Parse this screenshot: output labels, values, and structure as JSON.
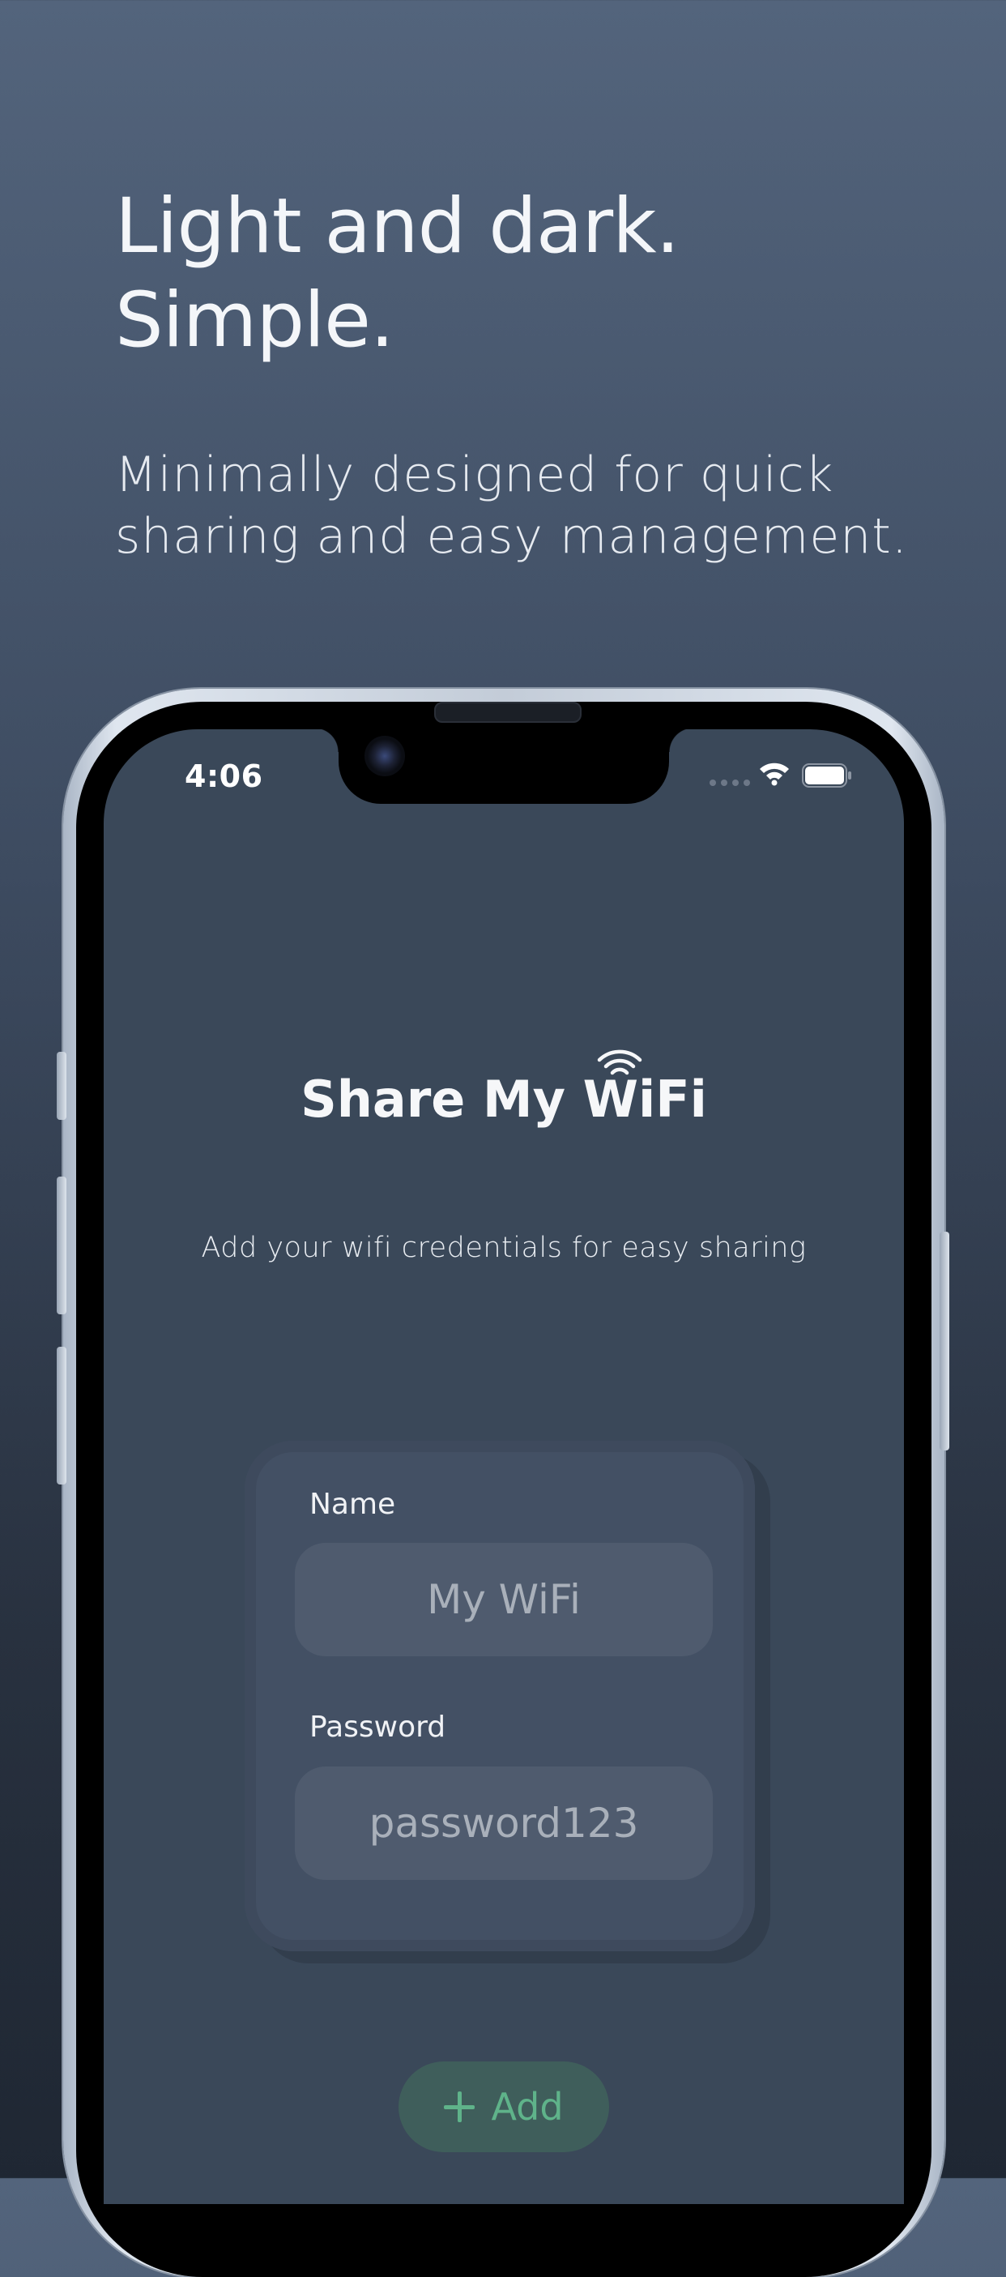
{
  "promo": {
    "headline_line1": "Light and dark.",
    "headline_line2": "Simple.",
    "subtitle_line1": "Minimally designed for quick",
    "subtitle_line2": "sharing and easy management."
  },
  "status_bar": {
    "time": "4:06",
    "icons": [
      "signal-icon",
      "wifi-icon",
      "battery-icon"
    ]
  },
  "app": {
    "title_prefix": "Share My ",
    "title_wifi": "WiFi",
    "subtitle": "Add your wifi credentials for easy sharing"
  },
  "form": {
    "name_label": "Name",
    "name_placeholder": "My WiFi",
    "password_label": "Password",
    "password_placeholder": "password123"
  },
  "actions": {
    "add_label": "Add"
  },
  "colors": {
    "screen_background": "#3a4859",
    "card_background": "#435064",
    "input_background": "#4f5b6e",
    "add_button_background": "#3f5e5b",
    "accent_green": "#5fb38a"
  }
}
